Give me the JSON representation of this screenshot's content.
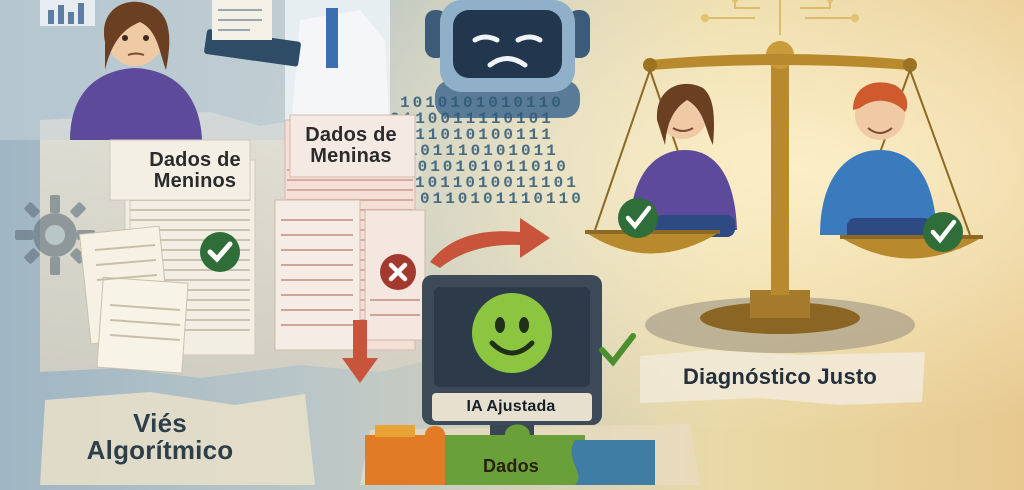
{
  "labels": {
    "boys_data": "Dados de Meninos",
    "girls_data": "Dados de Meninas",
    "fair_diagnosis": "Diagnóstico Justo",
    "algorithmic_bias": "Viés Algorítmico",
    "adjusted_ai": "IA Ajustada",
    "data_puzzle": "Dados"
  },
  "binary_stream": [
    "1010101010110",
    "0110011110101",
    "1011010100111",
    "0101110101011",
    "1010101011010",
    "1011010011101",
    "0110101110110"
  ],
  "icons": [
    "check-icon",
    "cross-icon",
    "arrow-right-icon",
    "arrow-down-icon",
    "smiley-icon",
    "sad-robot-icon",
    "balance-scale-icon",
    "puzzle-icon",
    "gear-icon"
  ],
  "colors": {
    "check_green": "#2f6d39",
    "cross_red": "#a43a2f",
    "arrow_red": "#c8543b",
    "smiley_green": "#8cc641",
    "screen_blue": "#2d3a49",
    "scale_gold": "#b88a2d",
    "hoodie_purple": "#5d4a9a",
    "shirt_blue": "#3a7bbd"
  }
}
